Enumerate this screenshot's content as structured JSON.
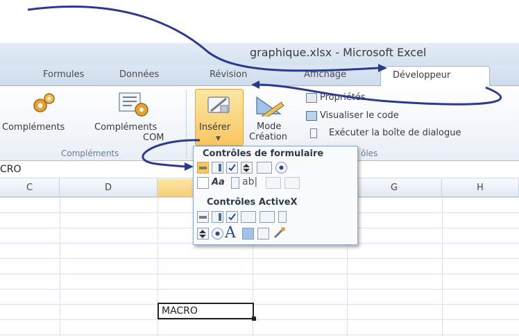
{
  "window": {
    "title": "graphique.xlsx - Microsoft Excel"
  },
  "tabs": [
    {
      "label": "Formules"
    },
    {
      "label": "Données"
    },
    {
      "label": "Révision"
    },
    {
      "label": "Affichage"
    },
    {
      "label": "Développeur"
    }
  ],
  "ribbon": {
    "complements_label": "Compléments",
    "complements_com_label_1": "Compléments",
    "complements_com_label_2": "COM",
    "group_complements_label": "Compléments",
    "inserer_label": "Insérer",
    "mode_creation_label_1": "Mode",
    "mode_creation_label_2": "Création",
    "proprietes_label": "Propriétés",
    "visualiser_code_label": "Visualiser le code",
    "executer_label": "Exécuter la boîte de dialogue",
    "group_controles_label_partial": "ôles"
  },
  "name_box": {
    "value": "CRO"
  },
  "columns": [
    "C",
    "D",
    "",
    "",
    "G",
    "H"
  ],
  "cells": {
    "active_value": "MACRO"
  },
  "dropdown": {
    "form_controls_header": "Contrôles de formulaire",
    "activex_header": "Contrôles ActiveX",
    "label_glyph": "Aa",
    "textbox_glyph": "ab|",
    "activex_label_glyph": "A"
  },
  "colors": {
    "accent": "#f8c660",
    "arrow": "#2a3a8c",
    "ribbon_bg": "#e9eef6"
  }
}
